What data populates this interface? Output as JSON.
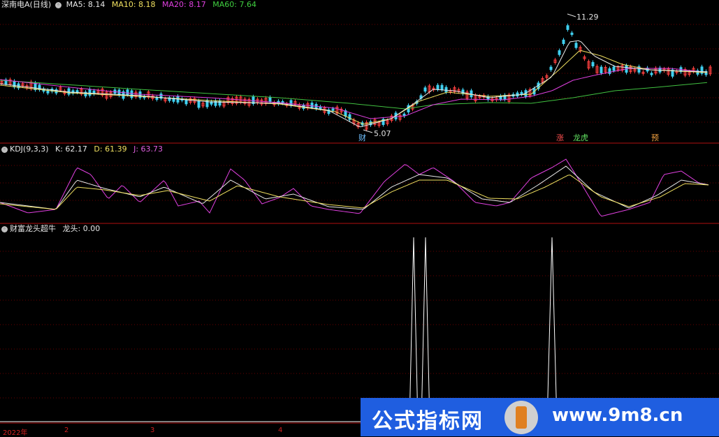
{
  "main_panel": {
    "title": "深南电A(日线)",
    "ma5": "MA5: 8.14",
    "ma10": "MA10: 8.18",
    "ma20": "MA20: 8.17",
    "ma60": "MA60: 7.64",
    "high_label": "11.29",
    "low_label": "5.07",
    "marker_cai": "财",
    "marker_zhang": "涨",
    "marker_longhu": "龙虎",
    "marker_yu": "预"
  },
  "kdj_panel": {
    "title": "KDJ(9,3,3)",
    "k": "K: 62.17",
    "d": "D: 61.39",
    "j": "J: 63.73"
  },
  "indicator_panel": {
    "title": "财富龙头超牛",
    "value": "龙头: 0.00"
  },
  "x_axis": {
    "labels": [
      "2022年",
      "2",
      "3",
      "4"
    ]
  },
  "watermark": {
    "left": "公式指标网",
    "right": "www.9m8.cn"
  },
  "colors": {
    "up": "#ff4040",
    "down": "#40d0f0",
    "ma5": "#e8e8e8",
    "ma10": "#f0e060",
    "ma20": "#e040e0",
    "ma60": "#40c040",
    "divider": "#b01010"
  }
}
